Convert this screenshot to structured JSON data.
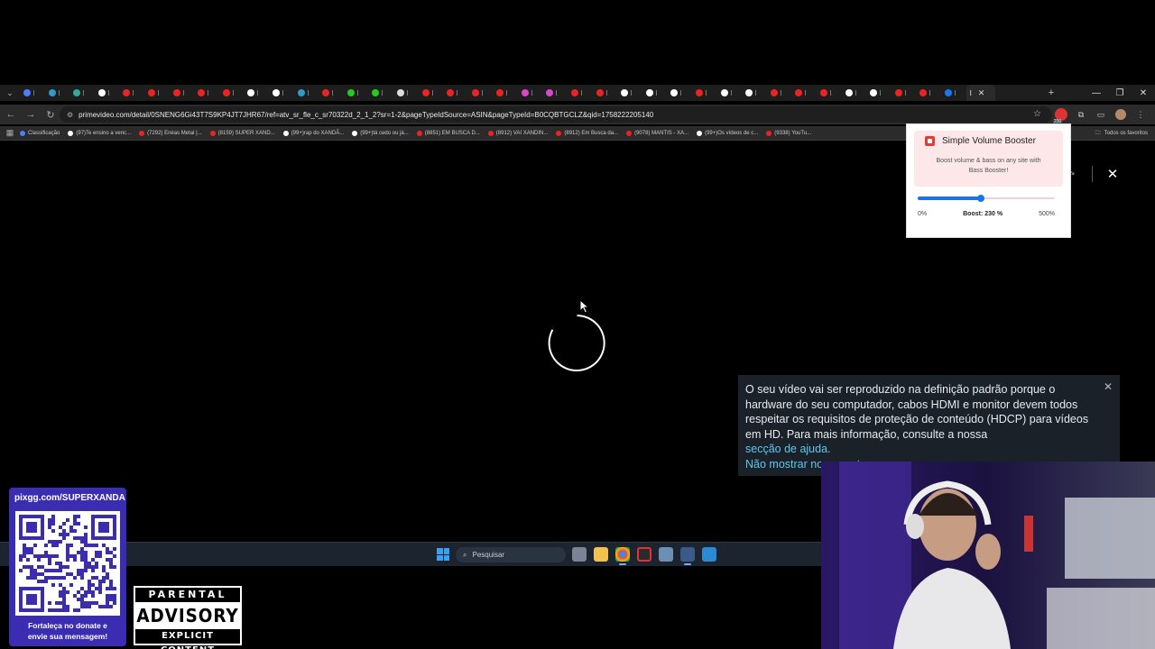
{
  "browser": {
    "active_tab_label": "I",
    "url": "primevideo.com/detail/0SNENG6Gi43T7S9KP4JT7JHR67/ref=atv_sr_fle_c_sr70322d_2_1_2?sr=1-2&pageTypeIdSource=ASIN&pageTypeId=B0CQBTGCLZ&qid=1758222205140",
    "tab_favicons": [
      "#4f7cff",
      "#39c",
      "#3a9",
      "#fff",
      "#e22",
      "#e22",
      "#e22",
      "#e22",
      "#e22",
      "#fff",
      "#fff",
      "#39c",
      "#e22",
      "#2c2",
      "#2c2",
      "#ddd",
      "#e22",
      "#e22",
      "#e22",
      "#e22",
      "#d4c",
      "#d4c",
      "#e22",
      "#e22",
      "#fff",
      "#fff",
      "#fff",
      "#e22",
      "#fff",
      "#fff",
      "#e22",
      "#e22",
      "#e22",
      "#fff",
      "#fff",
      "#e22",
      "#e22",
      "#1877f2"
    ],
    "bookmarks": [
      {
        "label": "Classificação",
        "color": "#4f7cff"
      },
      {
        "label": "(97)Te ensino a venc...",
        "color": "#fff"
      },
      {
        "label": "(7292) Enéas Metal |...",
        "color": "#e22"
      },
      {
        "label": "(8159) SUPER XAND...",
        "color": "#e22"
      },
      {
        "label": "(99+)rap do XANDÃ...",
        "color": "#fff"
      },
      {
        "label": "(99+)tá cedo ou já...",
        "color": "#fff"
      },
      {
        "label": "(8851) EM BUSCA D...",
        "color": "#e22"
      },
      {
        "label": "(8912) VAI XANDIN...",
        "color": "#e22"
      },
      {
        "label": "(8912) Em Busca da...",
        "color": "#e22"
      },
      {
        "label": "(9078) MANTIS - XA...",
        "color": "#e22"
      },
      {
        "label": "(99+)Os vídeos de c...",
        "color": "#fff"
      },
      {
        "label": "(9338) YouTu...",
        "color": "#e22"
      }
    ],
    "all_bookmarks_label": "Todos os favoritos",
    "extension_badge": "230"
  },
  "booster": {
    "title": "Simple Volume Booster",
    "description": "Boost volume & bass on any site with Bass Booster!",
    "min_label": "0%",
    "max_label": "500%",
    "boost_label": "Boost: 230 %",
    "boost_value": 230,
    "boost_max": 500
  },
  "notice": {
    "text": "O seu vídeo vai ser reproduzido na definição padrão porque o hardware do seu computador, cabos HDMI e monitor devem todos respeitar os requisitos de proteção de conteúdo (HDCP) para vídeos em HD. Para mais informação, consulte a nossa",
    "help_link": "secção de ajuda.",
    "dismiss_link": "Não mostrar novamente"
  },
  "taskbar": {
    "search_placeholder": "Pesquisar"
  },
  "overlays": {
    "pix_title": "pixgg.com/SUPERXANDA",
    "pix_message_line1": "Fortaleça no donate e",
    "pix_message_line2": "envie sua mensagem!",
    "advisory_top": "PARENTAL",
    "advisory_mid": "ADVISORY",
    "advisory_bot": "EXPLICIT CONTENT"
  }
}
